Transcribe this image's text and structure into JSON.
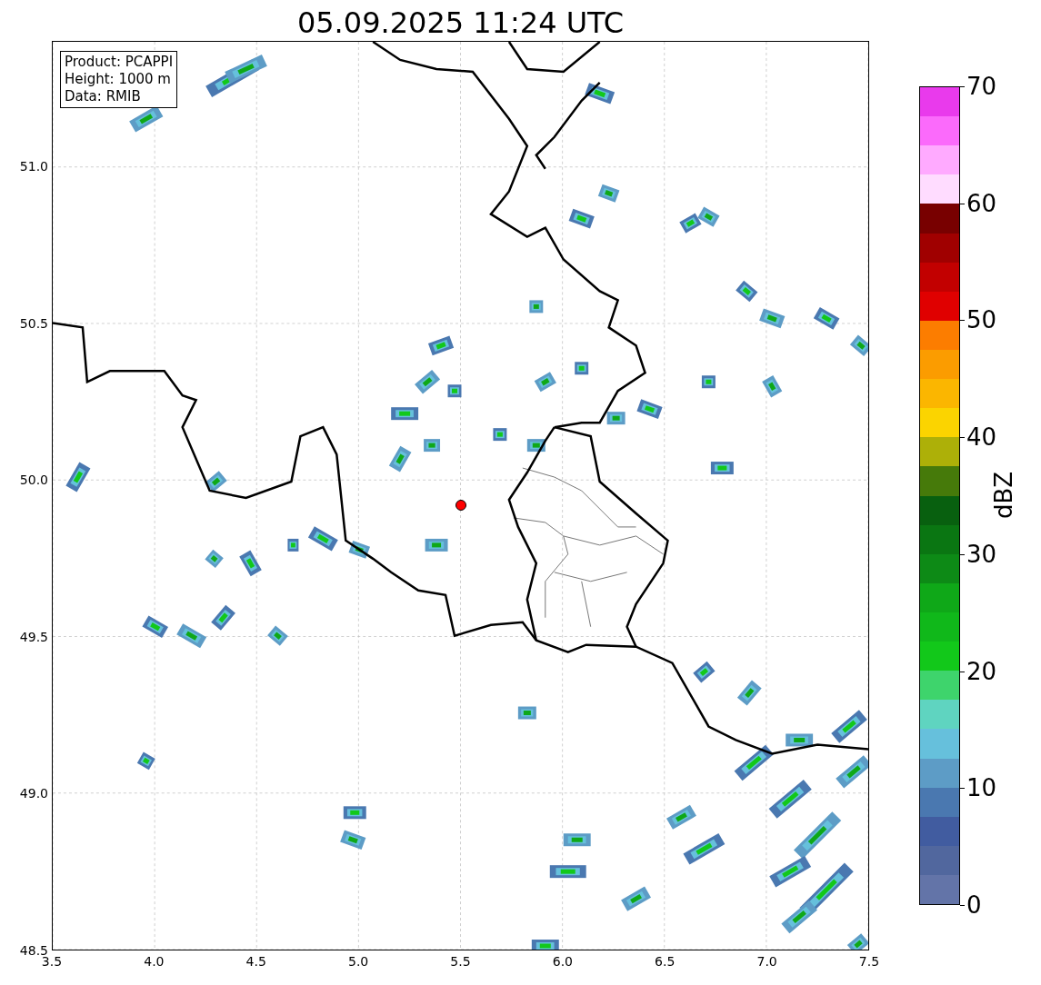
{
  "title": "05.09.2025 11:24 UTC",
  "info_box": [
    "Product: PCAPPI",
    "Height: 1000 m",
    "Data: RMIB"
  ],
  "x_axis": {
    "ticks": [
      "3.5",
      "4.0",
      "4.5",
      "5.0",
      "5.5",
      "6.0",
      "6.5",
      "7.0",
      "7.5"
    ]
  },
  "y_axis": {
    "ticks": [
      "51.0",
      "50.5",
      "50.0",
      "49.5",
      "49.0",
      "48.5"
    ]
  },
  "colorbar": {
    "label": "dBZ",
    "ticks": [
      "70",
      "60",
      "50",
      "40",
      "30",
      "20",
      "10",
      "0"
    ],
    "bins": [
      {
        "color": "#e93aec"
      },
      {
        "color": "#fb6afb"
      },
      {
        "color": "#ffaaff"
      },
      {
        "color": "#ffdcff"
      },
      {
        "color": "#780000"
      },
      {
        "color": "#a00000"
      },
      {
        "color": "#c20000"
      },
      {
        "color": "#e00000"
      },
      {
        "color": "#fc7d00"
      },
      {
        "color": "#fb9c00"
      },
      {
        "color": "#fbb600"
      },
      {
        "color": "#fbd400"
      },
      {
        "color": "#adb008"
      },
      {
        "color": "#467a0a"
      },
      {
        "color": "#08600f"
      },
      {
        "color": "#0a7612"
      },
      {
        "color": "#0d8a16"
      },
      {
        "color": "#0fa818"
      },
      {
        "color": "#10b81a"
      },
      {
        "color": "#12c81a"
      },
      {
        "color": "#3ed46c"
      },
      {
        "color": "#5fd4c0"
      },
      {
        "color": "#66c0dc"
      },
      {
        "color": "#5d9cc6"
      },
      {
        "color": "#4a78b0"
      },
      {
        "color": "#415ca0"
      },
      {
        "color": "#51679e"
      },
      {
        "color": "#6374a8"
      }
    ]
  }
}
